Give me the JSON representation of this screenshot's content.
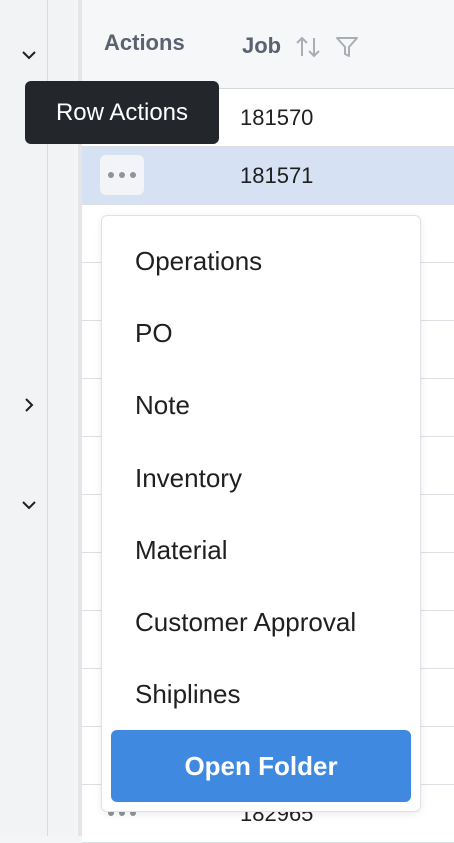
{
  "tooltip": {
    "text": "Row Actions"
  },
  "header": {
    "actions_label": "Actions",
    "job_label": "Job"
  },
  "rows": [
    {
      "job": "181570"
    },
    {
      "job": "181571"
    },
    {
      "job": "182965"
    }
  ],
  "menu": {
    "items": [
      {
        "label": "Operations"
      },
      {
        "label": "PO"
      },
      {
        "label": "Note"
      },
      {
        "label": "Inventory"
      },
      {
        "label": "Material"
      },
      {
        "label": "Customer Approval"
      },
      {
        "label": "Shiplines"
      }
    ],
    "primary_button": "Open Folder"
  },
  "colors": {
    "accent": "#3f8ae0",
    "selected_row": "#d6e2f3",
    "tooltip_bg": "#23272b"
  }
}
